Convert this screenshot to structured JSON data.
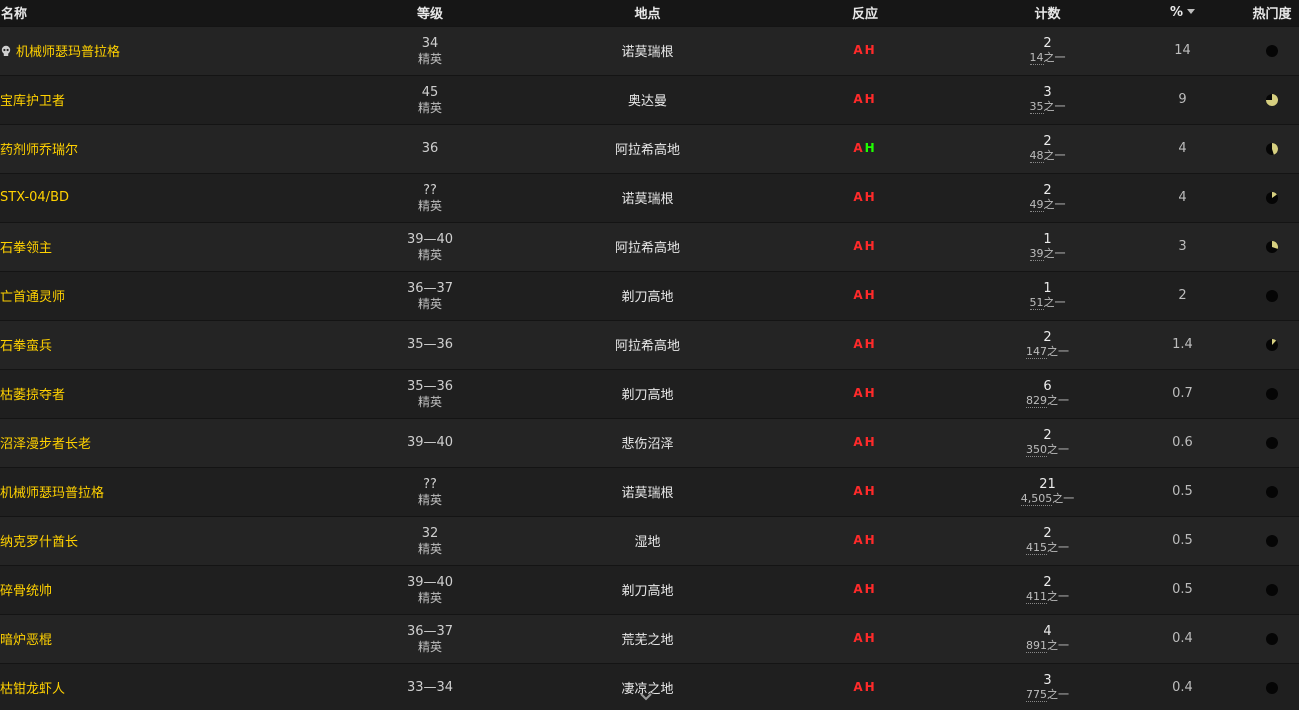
{
  "headers": {
    "name": "名称",
    "level": "等级",
    "location": "地点",
    "react": "反应",
    "count": "计数",
    "percent": "%",
    "popularity": "热门度"
  },
  "react_labels": {
    "a": "A",
    "h": "H"
  },
  "colors": {
    "name": "#ffd100",
    "hostile": "#ff2a2a",
    "friendly": "#1eff00",
    "pie_fill": "#d6cf80"
  },
  "rows": [
    {
      "skull": true,
      "name": "机械师瑟玛普拉格",
      "level": "34",
      "elite": "精英",
      "location": "诺莫瑞根",
      "h_friendly": false,
      "count": "2",
      "of_num": "14",
      "of_suffix": "之一",
      "percent": "14",
      "pie": 0
    },
    {
      "skull": false,
      "name": "宝库护卫者",
      "level": "45",
      "elite": "精英",
      "location": "奥达曼",
      "h_friendly": false,
      "count": "3",
      "of_num": "35",
      "of_suffix": "之一",
      "percent": "9",
      "pie": 0.75
    },
    {
      "skull": false,
      "name": "药剂师乔瑞尔",
      "level": "36",
      "elite": "",
      "location": "阿拉希高地",
      "h_friendly": true,
      "count": "2",
      "of_num": "48",
      "of_suffix": "之一",
      "percent": "4",
      "pie": 0.45
    },
    {
      "skull": false,
      "name": "STX-04/BD",
      "level": "??",
      "elite": "精英",
      "location": "诺莫瑞根",
      "h_friendly": false,
      "count": "2",
      "of_num": "49",
      "of_suffix": "之一",
      "percent": "4",
      "pie": 0.15
    },
    {
      "skull": false,
      "name": "石拳领主",
      "level": "39—40",
      "elite": "精英",
      "location": "阿拉希高地",
      "h_friendly": false,
      "count": "1",
      "of_num": "39",
      "of_suffix": "之一",
      "percent": "3",
      "pie": 0.3
    },
    {
      "skull": false,
      "name": "亡首通灵师",
      "level": "36—37",
      "elite": "精英",
      "location": "剃刀高地",
      "h_friendly": false,
      "count": "1",
      "of_num": "51",
      "of_suffix": "之一",
      "percent": "2",
      "pie": 0
    },
    {
      "skull": false,
      "name": "石拳蛮兵",
      "level": "35—36",
      "elite": "",
      "location": "阿拉希高地",
      "h_friendly": false,
      "count": "2",
      "of_num": "147",
      "of_suffix": "之一",
      "percent": "1.4",
      "pie": 0.12
    },
    {
      "skull": false,
      "name": "枯萎掠夺者",
      "level": "35—36",
      "elite": "精英",
      "location": "剃刀高地",
      "h_friendly": false,
      "count": "6",
      "of_num": "829",
      "of_suffix": "之一",
      "percent": "0.7",
      "pie": 0
    },
    {
      "skull": false,
      "name": "沼泽漫步者长老",
      "level": "39—40",
      "elite": "",
      "location": "悲伤沼泽",
      "h_friendly": false,
      "count": "2",
      "of_num": "350",
      "of_suffix": "之一",
      "percent": "0.6",
      "pie": 0
    },
    {
      "skull": false,
      "name": "机械师瑟玛普拉格",
      "level": "??",
      "elite": "精英",
      "location": "诺莫瑞根",
      "h_friendly": false,
      "count": "21",
      "of_num": "4,505",
      "of_suffix": "之一",
      "percent": "0.5",
      "pie": 0
    },
    {
      "skull": false,
      "name": "纳克罗什酋长",
      "level": "32",
      "elite": "精英",
      "location": "湿地",
      "h_friendly": false,
      "count": "2",
      "of_num": "415",
      "of_suffix": "之一",
      "percent": "0.5",
      "pie": 0
    },
    {
      "skull": false,
      "name": "碎骨统帅",
      "level": "39—40",
      "elite": "精英",
      "location": "剃刀高地",
      "h_friendly": false,
      "count": "2",
      "of_num": "411",
      "of_suffix": "之一",
      "percent": "0.5",
      "pie": 0
    },
    {
      "skull": false,
      "name": "暗炉恶棍",
      "level": "36—37",
      "elite": "精英",
      "location": "荒芜之地",
      "h_friendly": false,
      "count": "4",
      "of_num": "891",
      "of_suffix": "之一",
      "percent": "0.4",
      "pie": 0
    },
    {
      "skull": false,
      "name": "枯钳龙虾人",
      "level": "33—34",
      "elite": "",
      "location": "凄凉之地",
      "h_friendly": false,
      "count": "3",
      "of_num": "775",
      "of_suffix": "之一",
      "percent": "0.4",
      "pie": 0
    }
  ]
}
